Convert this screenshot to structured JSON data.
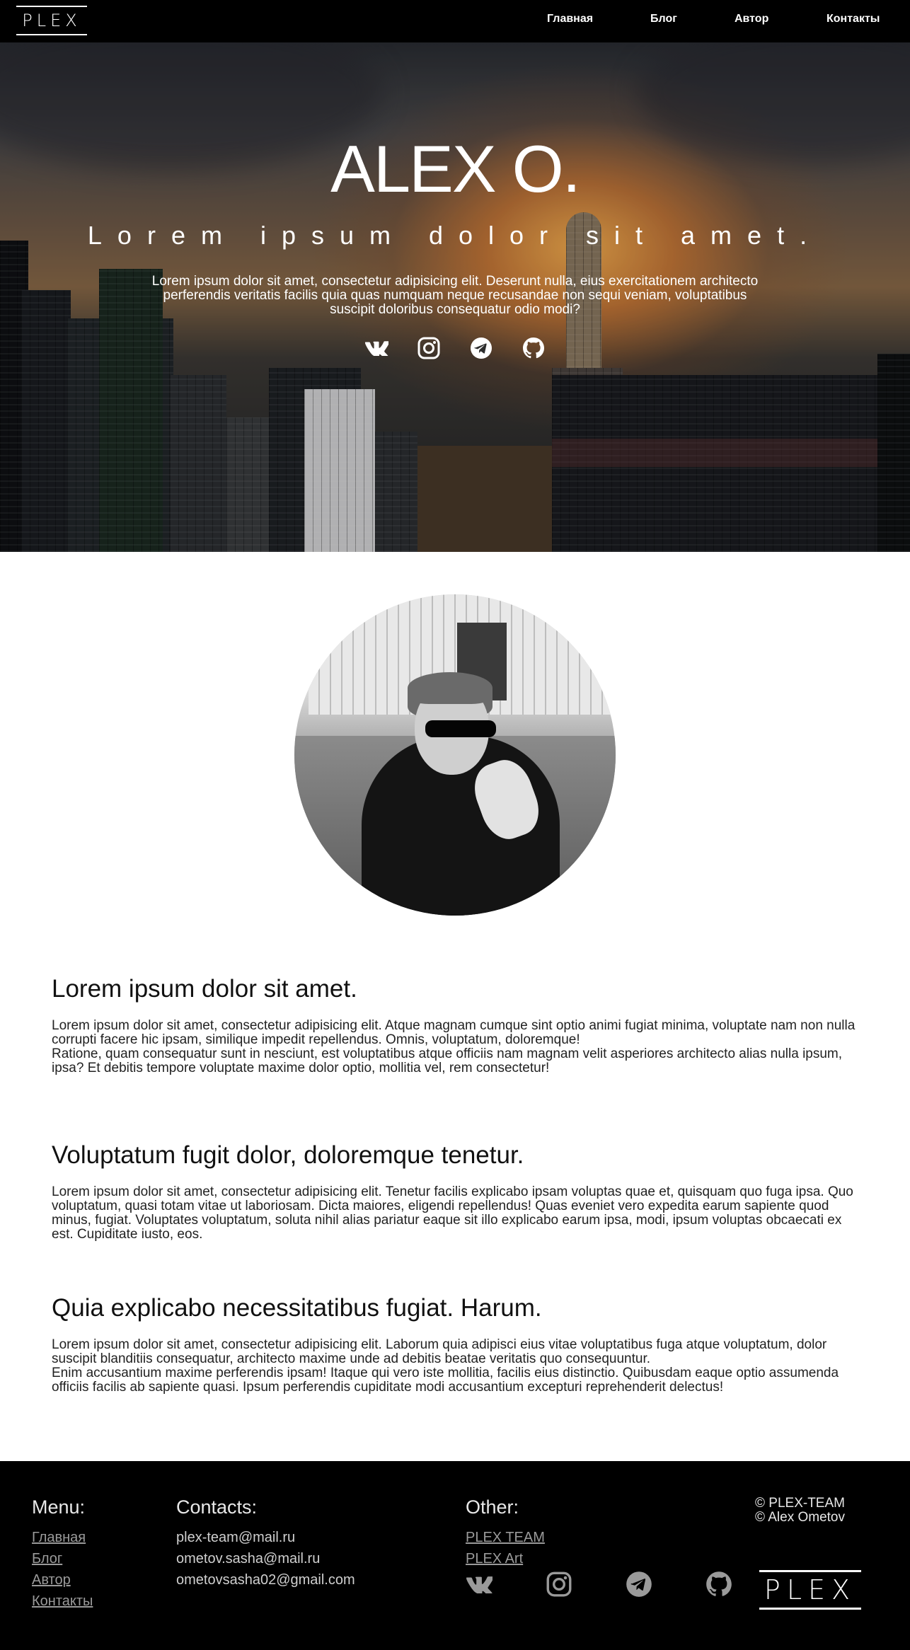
{
  "nav": {
    "logo": "PLEX",
    "links": [
      "Главная",
      "Блог",
      "Автор",
      "Контакты"
    ]
  },
  "hero": {
    "title": "ALEX O.",
    "subtitle": "Lorem ipsum dolor sit amet.",
    "text": "Lorem ipsum dolor sit amet, consectetur adipisicing elit. Deserunt nulla, eius exercitationem architecto perferendis veritatis facilis quia quas numquam neque recusandae non sequi veniam, voluptatibus suscipit doloribus consequatur odio modi?",
    "icons": [
      "vk-icon",
      "instagram-icon",
      "telegram-icon",
      "github-icon"
    ]
  },
  "sections": [
    {
      "title": "Lorem ipsum dolor sit amet.",
      "p1": "Lorem ipsum dolor sit amet, consectetur adipisicing elit. Atque magnam cumque sint optio animi fugiat minima, voluptate nam non nulla corrupti facere hic ipsam, similique impedit repellendus. Omnis, voluptatum, doloremque!",
      "p2": "Ratione, quam consequatur sunt in nesciunt, est voluptatibus atque officiis nam magnam velit asperiores architecto alias nulla ipsum, ipsa? Et debitis tempore voluptate maxime dolor optio, mollitia vel, rem consectetur!"
    },
    {
      "title": "Voluptatum fugit dolor, doloremque tenetur.",
      "p1": "Lorem ipsum dolor sit amet, consectetur adipisicing elit. Tenetur facilis explicabo ipsam voluptas quae et, quisquam quo fuga ipsa. Quo voluptatum, quasi totam vitae ut laboriosam. Dicta maiores, eligendi repellendus! Quas eveniet vero expedita earum sapiente quod minus, fugiat. Voluptates voluptatum, soluta nihil alias pariatur eaque sit illo explicabo earum ipsa, modi, ipsum voluptas obcaecati ex est. Cupiditate iusto, eos.",
      "p2": ""
    },
    {
      "title": "Quia explicabo necessitatibus fugiat. Harum.",
      "p1": "Lorem ipsum dolor sit amet, consectetur adipisicing elit. Laborum quia adipisci eius vitae voluptatibus fuga atque voluptatum, dolor suscipit blanditiis consequatur, architecto maxime unde ad debitis beatae veritatis quo consequuntur.",
      "p2": "Enim accusantium maxime perferendis ipsam! Itaque qui vero iste mollitia, facilis eius distinctio. Quibusdam eaque optio assumenda officiis facilis ab sapiente quasi. Ipsum perferendis cupiditate modi accusantium excepturi reprehenderit delectus!"
    }
  ],
  "footer": {
    "menu_title": "Menu:",
    "menu_items": [
      "Главная",
      "Блог",
      "Автор",
      "Контакты"
    ],
    "contacts_title": "Contacts:",
    "contacts": [
      "plex-team@mail.ru",
      "ometov.sasha@mail.ru",
      "ometovsasha02@gmail.com"
    ],
    "other_title": "Other:",
    "other_items": [
      "PLEX TEAM",
      "PLEX Art"
    ],
    "copyright_1": "© PLEX-TEAM",
    "copyright_2": "© Alex Ometov",
    "logo": "PLEX",
    "icons": [
      "vk-icon",
      "instagram-icon",
      "telegram-icon",
      "github-icon"
    ]
  },
  "colors": {
    "nav_bg": "#000000",
    "footer_bg": "#000000",
    "text": "#111111",
    "hero_glow": "#ffb450"
  }
}
